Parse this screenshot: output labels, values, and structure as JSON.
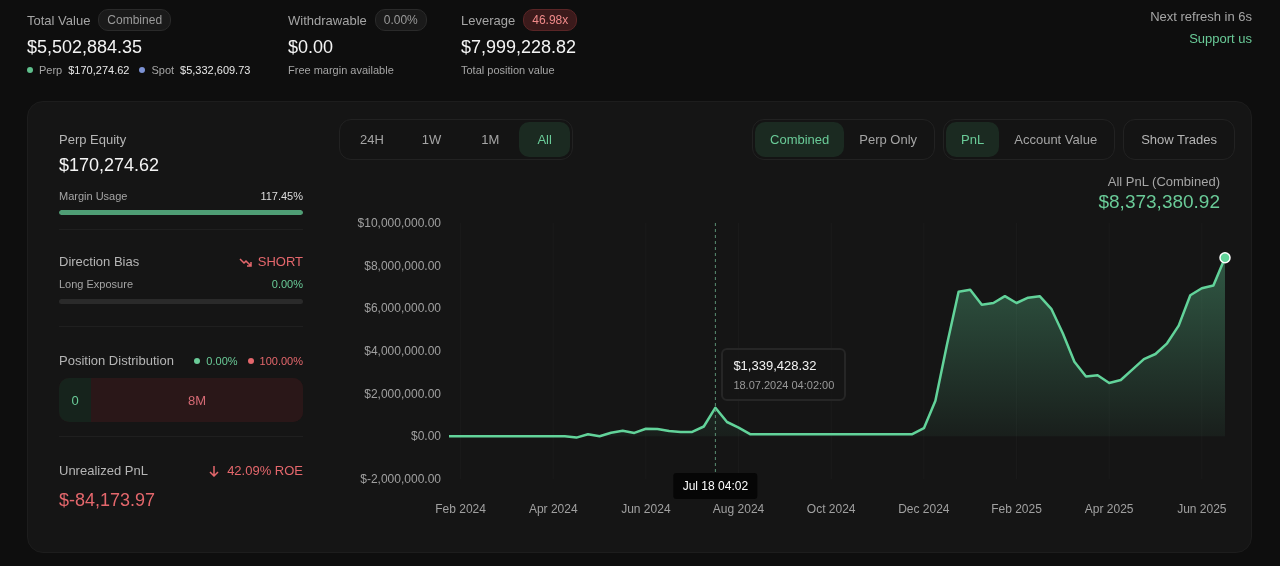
{
  "header": {
    "stats": [
      {
        "label": "Total Value",
        "badge": "Combined",
        "alert": false,
        "value": "$5,502,884.35",
        "breakdown": [
          {
            "label": "Perp",
            "value": "$170,274.62",
            "color": "#5fbf8c"
          },
          {
            "label": "Spot",
            "value": "$5,332,609.73",
            "color": "#7c92d4"
          }
        ]
      },
      {
        "label": "Withdrawable",
        "badge": "0.00%",
        "alert": false,
        "value": "$0.00",
        "caption": "Free margin available"
      },
      {
        "label": "Leverage",
        "badge": "46.98x",
        "alert": true,
        "value": "$7,999,228.82",
        "caption": "Total position value"
      }
    ],
    "refresh": "Next refresh in 6s",
    "support_link": "Support us"
  },
  "summary": {
    "perp_equity": {
      "label": "Perp Equity",
      "value": "$170,274.62",
      "meter_label": "Margin Usage",
      "meter_reading": "117.45%",
      "level": 1
    },
    "direction": {
      "label": "Direction Bias",
      "bias": "SHORT",
      "falling": true,
      "exposure_label": "Long Exposure",
      "exposure_reading": "0.00%",
      "level": 0
    },
    "distribution": {
      "label": "Position Distribution",
      "long_share": "0.00%",
      "short_share": "100.00%",
      "long_amount": "0",
      "short_amount": "8M"
    },
    "unrealized": {
      "label": "Unrealized PnL",
      "roe": "42.09% ROE",
      "falling": true,
      "value": "$-84,173.97"
    }
  },
  "controls": {
    "ranges": [
      {
        "label": "24H",
        "selected": false
      },
      {
        "label": "1W",
        "selected": false
      },
      {
        "label": "1M",
        "selected": false
      },
      {
        "label": "All",
        "selected": true
      }
    ],
    "scopes": [
      {
        "label": "Combined",
        "selected": true
      },
      {
        "label": "Perp Only",
        "selected": false
      }
    ],
    "metrics": [
      {
        "label": "PnL",
        "selected": true
      },
      {
        "label": "Account Value",
        "selected": false
      }
    ],
    "show_trades": "Show Trades"
  },
  "chart": {
    "title": "All PnL (Combined)",
    "total": "$8,373,380.92",
    "tooltip": {
      "value": "$1,339,428.32",
      "time": "18.07.2024 04:02:00",
      "axis_label": "Jul 18 04:02"
    },
    "chart_data": {
      "type": "area",
      "ylim": [
        -2000000,
        10000000
      ],
      "categories": [
        null,
        "Feb 2024",
        null,
        null,
        null,
        null,
        null,
        null,
        null,
        "Apr 2024",
        null,
        null,
        null,
        null,
        null,
        null,
        null,
        "Jun 2024",
        null,
        null,
        null,
        null,
        null,
        null,
        null,
        "Aug 2024",
        null,
        null,
        null,
        null,
        null,
        null,
        null,
        "Oct 2024",
        null,
        null,
        null,
        null,
        null,
        null,
        null,
        "Dec 2024",
        null,
        null,
        null,
        null,
        null,
        null,
        null,
        "Feb 2025",
        null,
        null,
        null,
        null,
        null,
        null,
        null,
        "Apr 2025",
        null,
        null,
        null,
        null,
        null,
        null,
        null,
        "Jun 2025",
        null,
        null
      ],
      "yticks": [
        {
          "value": 10000000,
          "label": "$10,000,000.00"
        },
        {
          "value": 8000000,
          "label": "$8,000,000.00"
        },
        {
          "value": 6000000,
          "label": "$6,000,000.00"
        },
        {
          "value": 4000000,
          "label": "$4,000,000.00"
        },
        {
          "value": 2000000,
          "label": "$2,000,000.00"
        },
        {
          "value": 0,
          "label": "$0.00"
        },
        {
          "value": -2000000,
          "label": "$-2,000,000.00"
        }
      ],
      "series": [
        {
          "color": "#62d39a",
          "values": [
            0,
            0,
            0,
            0,
            0,
            0,
            0,
            0,
            0,
            0,
            0,
            -60000,
            100000,
            0,
            170000,
            260000,
            160000,
            360000,
            350000,
            250000,
            210000,
            210000,
            460000,
            1340000,
            670000,
            410000,
            100000,
            100000,
            100000,
            100000,
            100000,
            100000,
            100000,
            100000,
            100000,
            100000,
            100000,
            100000,
            100000,
            100000,
            100000,
            380000,
            1670000,
            4300000,
            6780000,
            6870000,
            6170000,
            6250000,
            6570000,
            6250000,
            6500000,
            6570000,
            5980000,
            4820000,
            3500000,
            2800000,
            2860000,
            2500000,
            2640000,
            3130000,
            3620000,
            3860000,
            4360000,
            5190000,
            6610000,
            6940000,
            7070000,
            8370000
          ]
        }
      ]
    }
  }
}
